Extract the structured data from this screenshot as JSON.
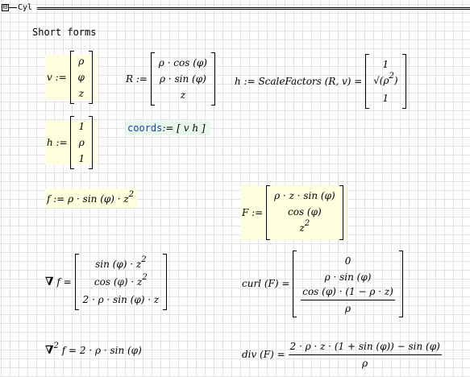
{
  "region": {
    "collapse_glyph": "⊟",
    "title": "Cyl"
  },
  "heading": "Short forms",
  "v_def": {
    "lhs": "v :=",
    "entries": [
      "ρ",
      "φ",
      "z"
    ]
  },
  "R_def": {
    "lhs": "R :=",
    "entries": [
      "ρ · cos (φ)",
      "ρ · sin (φ)",
      "z"
    ]
  },
  "h_scale": {
    "lhs": "h := ScaleFactors (R, v) =",
    "entries": [
      "1",
      "ρ",
      "1"
    ],
    "exponent": "2"
  },
  "h_def": {
    "lhs": "h :=",
    "entries": [
      "1",
      "ρ",
      "1"
    ]
  },
  "coords": {
    "name": "coords",
    "assign": ":=",
    "value": "[ v  h ]"
  },
  "f_def": {
    "lhs": "f := ρ · sin (φ) · z",
    "exponent": "2"
  },
  "F_def": {
    "lhs": "F :=",
    "entries": [
      "ρ · z · sin (φ)",
      "cos (φ)",
      "z"
    ],
    "exponent": "2"
  },
  "grad": {
    "symbol": "∇",
    "lhs": "f =",
    "entries": [
      "sin (φ) · z",
      "cos (φ) · z",
      "2 · ρ · sin (φ) · z"
    ],
    "exponent": "2"
  },
  "curl": {
    "lhs": "curl (F) =",
    "entries": [
      "0",
      "ρ · sin (φ)"
    ],
    "frac_num": "cos (φ) · (1 − ρ · z)",
    "frac_den": "ρ"
  },
  "laplace": {
    "symbol": "∇",
    "exponent": "2",
    "rhs": "f = 2 · ρ · sin (φ)"
  },
  "div": {
    "lhs": "div (F) =",
    "frac_num": "2 · ρ · z · (1 + sin (φ)) − sin (φ)",
    "frac_den": "ρ"
  }
}
